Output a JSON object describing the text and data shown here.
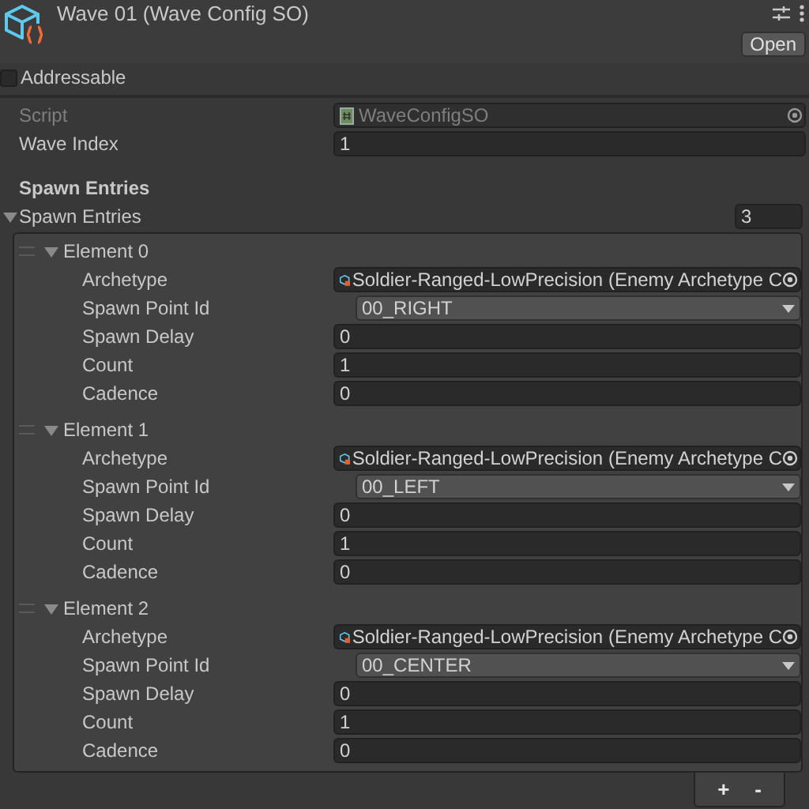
{
  "header": {
    "title": "Wave 01 (Wave Config SO)",
    "open_button": "Open"
  },
  "addressable": {
    "label": "Addressable",
    "checked": false
  },
  "script": {
    "label": "Script",
    "value": "WaveConfigSO",
    "disabled": true
  },
  "wave_index": {
    "label": "Wave Index",
    "value": "1"
  },
  "section_header": "Spawn Entries",
  "list": {
    "label": "Spawn Entries",
    "expanded": true,
    "size": "3",
    "elements": [
      {
        "label": "Element 0",
        "expanded": true,
        "fields": [
          {
            "kind": "object",
            "label": "Archetype",
            "value": "Soldier-Ranged-LowPrecision (Enemy Archetype C"
          },
          {
            "kind": "dropdown",
            "label": "Spawn Point Id",
            "value": "00_RIGHT"
          },
          {
            "kind": "number",
            "label": "Spawn Delay",
            "value": "0"
          },
          {
            "kind": "number",
            "label": "Count",
            "value": "1"
          },
          {
            "kind": "number",
            "label": "Cadence",
            "value": "0"
          }
        ]
      },
      {
        "label": "Element 1",
        "expanded": true,
        "fields": [
          {
            "kind": "object",
            "label": "Archetype",
            "value": "Soldier-Ranged-LowPrecision (Enemy Archetype C"
          },
          {
            "kind": "dropdown",
            "label": "Spawn Point Id",
            "value": "00_LEFT"
          },
          {
            "kind": "number",
            "label": "Spawn Delay",
            "value": "0"
          },
          {
            "kind": "number",
            "label": "Count",
            "value": "1"
          },
          {
            "kind": "number",
            "label": "Cadence",
            "value": "0"
          }
        ]
      },
      {
        "label": "Element 2",
        "expanded": true,
        "fields": [
          {
            "kind": "object",
            "label": "Archetype",
            "value": "Soldier-Ranged-LowPrecision (Enemy Archetype C"
          },
          {
            "kind": "dropdown",
            "label": "Spawn Point Id",
            "value": "00_CENTER"
          },
          {
            "kind": "number",
            "label": "Spawn Delay",
            "value": "0"
          },
          {
            "kind": "number",
            "label": "Count",
            "value": "1"
          },
          {
            "kind": "number",
            "label": "Cadence",
            "value": "0"
          }
        ]
      }
    ]
  },
  "footer": {
    "add": "+",
    "remove": "-"
  }
}
